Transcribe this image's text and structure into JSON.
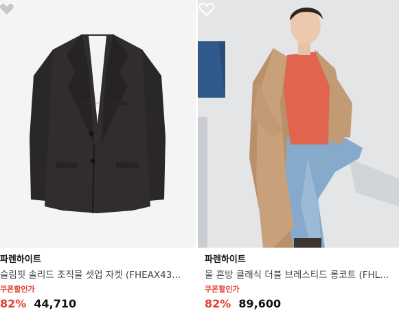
{
  "products": [
    {
      "brand": "파렌하이트",
      "name": "슬림핏 솔리드 조직물 셋업 자켓 (FHEAX43...",
      "coupon_label": "쿠폰할인가",
      "discount": "82%",
      "price": "44,710",
      "wishlist_icon": "heart-outline-icon",
      "image": "black-suit-jacket"
    },
    {
      "brand": "파렌하이트",
      "name": "울 혼방 클래식 더블 브레스티드 롱코트 (FHL...",
      "coupon_label": "쿠폰할인가",
      "discount": "82%",
      "price": "89,600",
      "wishlist_icon": "heart-outline-icon",
      "image": "model-in-camel-long-coat"
    }
  ],
  "colors": {
    "accent_red": "#e0402e",
    "text": "#111111",
    "muted": "#444444"
  }
}
